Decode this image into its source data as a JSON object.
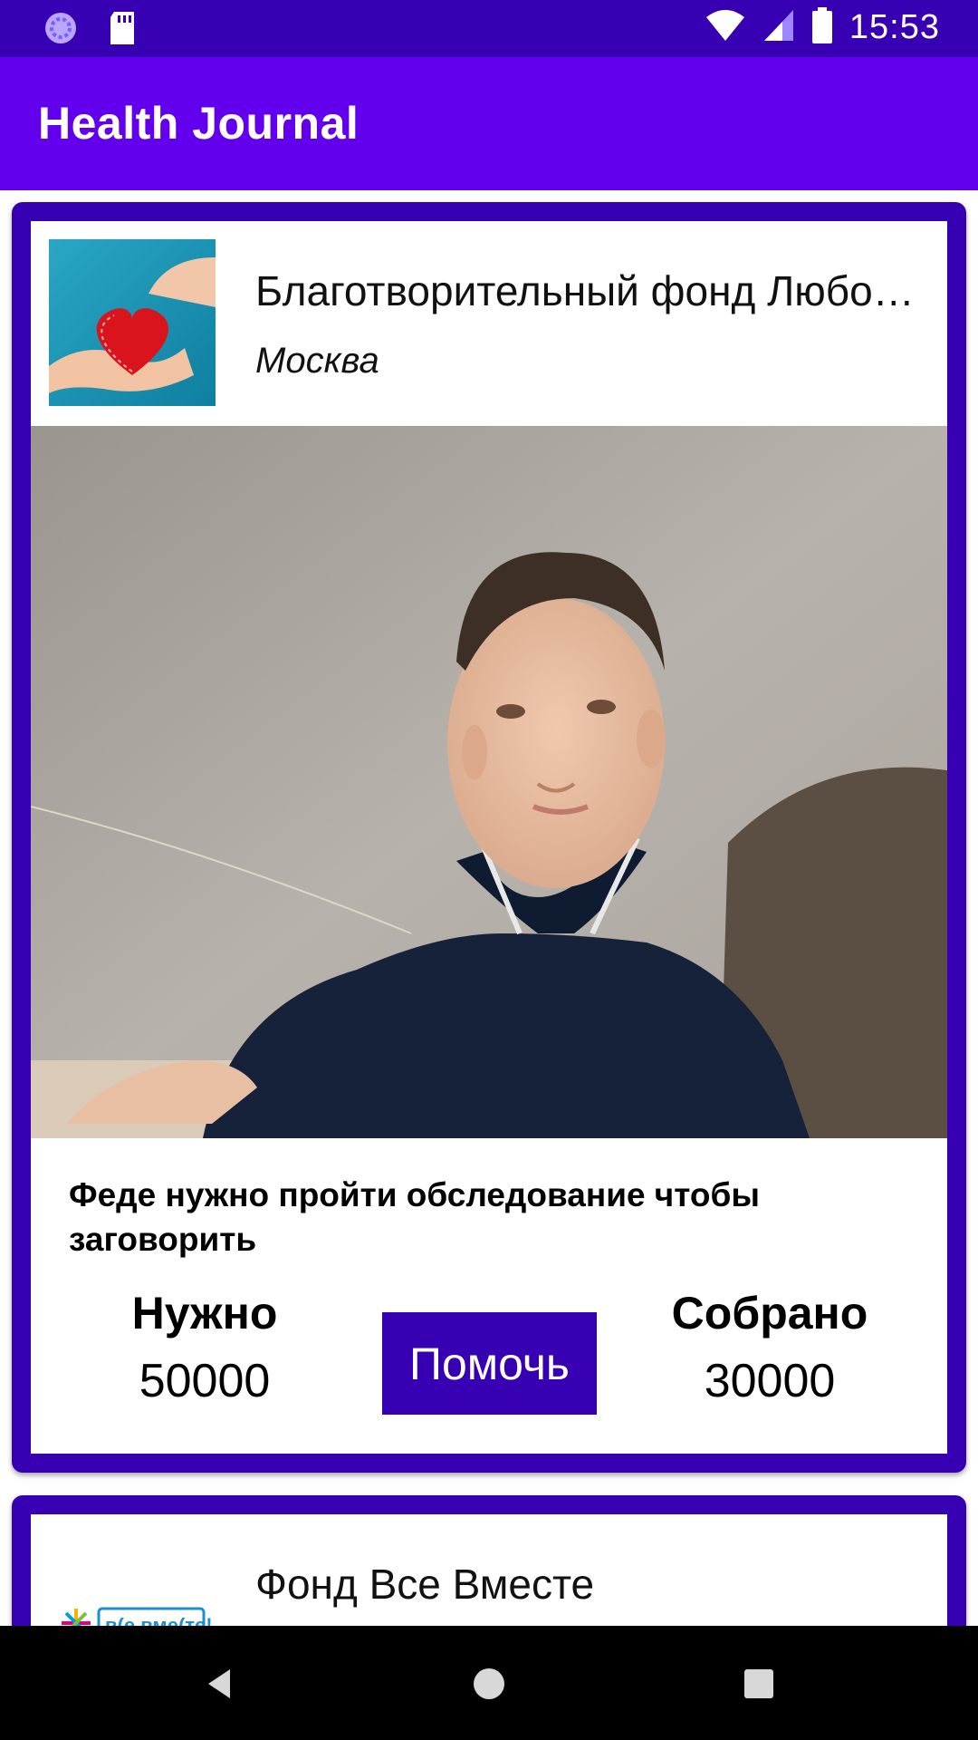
{
  "status_bar": {
    "time": "15:53",
    "icons": [
      "sync-icon",
      "sd-card-icon",
      "wifi-icon",
      "signal-icon",
      "battery-icon"
    ]
  },
  "app_bar": {
    "title": "Health Journal",
    "background": "#6200ee"
  },
  "cards": [
    {
      "org_name": "Благотворительный фонд Любо…",
      "city": "Москва",
      "logo": "heart-in-hands-image",
      "photo": "child-photo",
      "description": "Феде нужно пройти обследование чтобы заговорить",
      "needed_label": "Нужно",
      "needed_value": "50000",
      "collected_label": "Собрано",
      "collected_value": "30000",
      "help_button": "Помочь"
    },
    {
      "org_name": "Фонд Все Вместе",
      "logo": "vse-vmeste-logo",
      "logo_text": "в(е вме(те!"
    }
  ],
  "nav_bar": {
    "icons": [
      "back-icon",
      "home-icon",
      "recents-icon"
    ]
  },
  "colors": {
    "primary": "#6200ee",
    "primary_dark": "#3700b3"
  }
}
